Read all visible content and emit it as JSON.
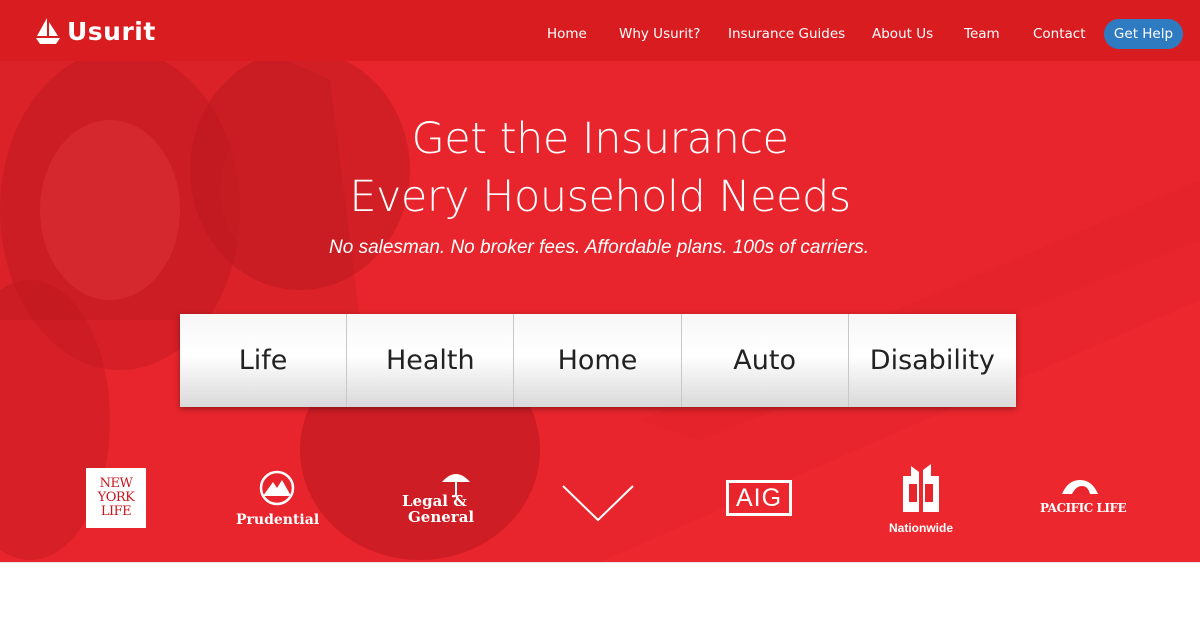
{
  "brand": {
    "name": "Usurit",
    "icon": "sailboat-icon"
  },
  "nav": {
    "items": [
      {
        "label": "Home"
      },
      {
        "label": "Why Usurit?"
      },
      {
        "label": "Insurance Guides"
      },
      {
        "label": "About Us"
      },
      {
        "label": "Team"
      },
      {
        "label": "Contact"
      }
    ],
    "cta_label": "Get Help"
  },
  "hero": {
    "headline_line1": "Get the Insurance",
    "headline_line2": "Every Household Needs",
    "subheadline": "No salesman. No broker fees. Affordable plans. 100s of carriers."
  },
  "categories": [
    {
      "label": "Life"
    },
    {
      "label": "Health"
    },
    {
      "label": "Home"
    },
    {
      "label": "Auto"
    },
    {
      "label": "Disability"
    }
  ],
  "carriers": {
    "new_york_life": {
      "line1": "NEW",
      "line2": "YORK",
      "line3": "LIFE"
    },
    "prudential": {
      "name": "Prudential"
    },
    "legal_general": {
      "line1": "Legal &",
      "line2": "General"
    },
    "aig": {
      "name": "AIG"
    },
    "nationwide": {
      "name": "Nationwide"
    },
    "pacific_life": {
      "name": "PACIFIC LIFE"
    }
  },
  "colors": {
    "hero_red": "#e8252c",
    "nav_red": "#d91c20",
    "cta_blue": "#2f7bc2",
    "text_white": "#ffffff"
  }
}
